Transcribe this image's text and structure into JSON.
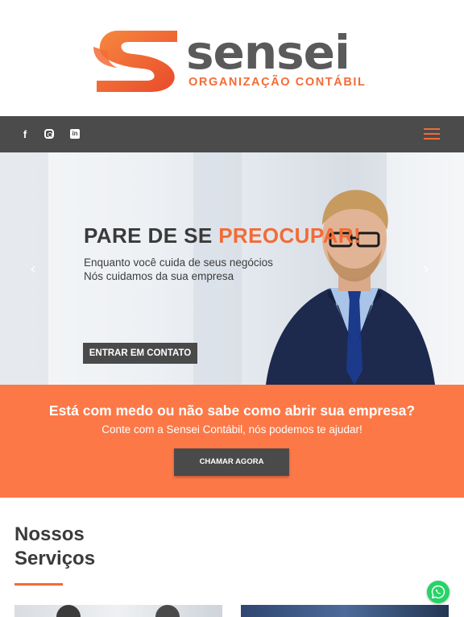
{
  "brand": {
    "name": "sensei",
    "tagline": "ORGANIZAÇÃO CONTÁBIL",
    "accent_color": "#f36b36",
    "text_color": "#5a5a5a"
  },
  "topbar": {
    "social_icons": [
      "facebook-icon",
      "instagram-icon",
      "linkedin-icon"
    ],
    "menu_icon": "hamburger-menu-icon",
    "background": "#4b4b4b"
  },
  "hero": {
    "title_part1": "PARE DE SE ",
    "title_part2": "PREOCUPAR!",
    "line1": "Enquanto você cuida de seus negócios",
    "line2": "Nós cuidamos da sua empresa",
    "button_label": "ENTRAR EM CONTATO",
    "prev_arrow": "‹",
    "next_arrow": "›"
  },
  "cta": {
    "title": "Está com medo ou não sabe como abrir sua empresa?",
    "subtitle": "Conte com a Sensei Contábil, nós podemos te ajudar!",
    "button_label": "CHAMAR AGORA",
    "background": "#fd7847"
  },
  "services": {
    "title_line1": "Nossos",
    "title_line2": "Serviços"
  },
  "floating": {
    "whatsapp_icon": "whatsapp-icon",
    "color": "#25d366"
  }
}
